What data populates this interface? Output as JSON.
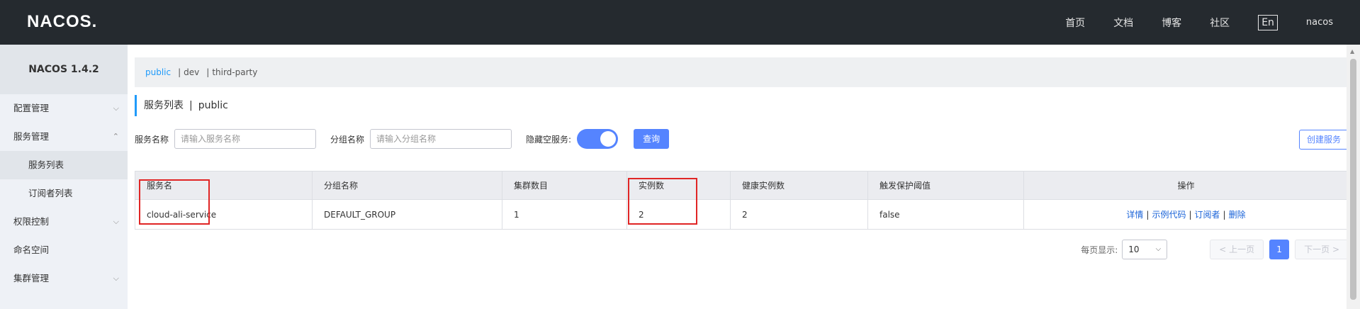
{
  "header": {
    "logo": "NACOS.",
    "nav": [
      "首页",
      "文档",
      "博客",
      "社区"
    ],
    "lang": "En",
    "user": "nacos"
  },
  "sidebar": {
    "title": "NACOS 1.4.2",
    "items": [
      {
        "label": "配置管理",
        "chev": "⌵"
      },
      {
        "label": "服务管理",
        "chev": "⌃"
      },
      {
        "label": "服务列表"
      },
      {
        "label": "订阅者列表"
      },
      {
        "label": "权限控制",
        "chev": "⌵"
      },
      {
        "label": "命名空间"
      },
      {
        "label": "集群管理",
        "chev": "⌵"
      }
    ]
  },
  "namespaces": [
    "public",
    "dev",
    "third-party"
  ],
  "page": {
    "title": "服务列表",
    "namespace": "public"
  },
  "filter": {
    "service_label": "服务名称",
    "service_placeholder": "请输入服务名称",
    "group_label": "分组名称",
    "group_placeholder": "请输入分组名称",
    "hide_empty_label": "隐藏空服务:",
    "query_button": "查询",
    "create_button": "创建服务"
  },
  "table": {
    "columns": [
      "服务名",
      "分组名称",
      "集群数目",
      "实例数",
      "健康实例数",
      "触发保护阈值",
      "操作"
    ],
    "rows": [
      {
        "service": "cloud-ali-service",
        "group": "DEFAULT_GROUP",
        "clusters": "1",
        "instances": "2",
        "healthy": "2",
        "threshold": "false",
        "ops": [
          "详情",
          "示例代码",
          "订阅者",
          "删除"
        ]
      }
    ]
  },
  "pager": {
    "label": "每页显示:",
    "page_size": "10",
    "prev": "< 上一页",
    "current": "1",
    "next": "下一页 >"
  },
  "colors": {
    "accent": "#5584ff",
    "topbar": "#252a2f",
    "highlight": "#e02525"
  }
}
